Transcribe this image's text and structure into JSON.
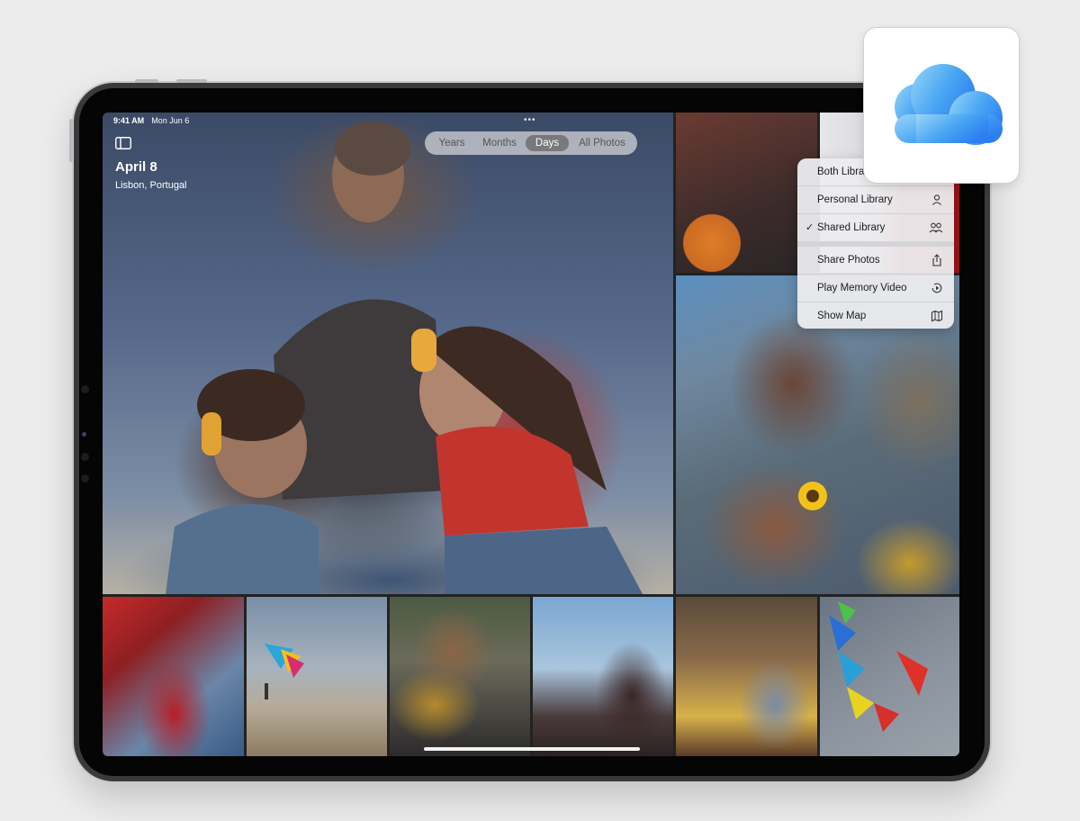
{
  "status_bar": {
    "time": "9:41 AM",
    "date": "Mon Jun 6"
  },
  "header": {
    "top_dots": "•••",
    "title": "April 8",
    "subtitle": "Lisbon, Portugal"
  },
  "view_switcher": {
    "items": [
      {
        "label": "Years",
        "active": false
      },
      {
        "label": "Months",
        "active": false
      },
      {
        "label": "Days",
        "active": true
      },
      {
        "label": "All Photos",
        "active": false
      }
    ]
  },
  "menu": {
    "items": [
      {
        "label": "Both Libraries",
        "icon": "photos-icon",
        "checked": false
      },
      {
        "label": "Personal Library",
        "icon": "person-icon",
        "checked": false
      },
      {
        "label": "Shared Library",
        "icon": "people-icon",
        "checked": true
      },
      {
        "label": "Share Photos",
        "icon": "share-icon"
      },
      {
        "label": "Play Memory Video",
        "icon": "memory-play-icon"
      },
      {
        "label": "Show Map",
        "icon": "map-icon"
      }
    ],
    "check_mark": "✓"
  },
  "app_icon": {
    "name": "iCloud",
    "icon": "cloud-icon",
    "colors": {
      "light": "#8fd0f7",
      "dark": "#2b7ff0"
    }
  },
  "device": {
    "frame_color": "#3a3a3c",
    "accent": "#ffffff"
  }
}
